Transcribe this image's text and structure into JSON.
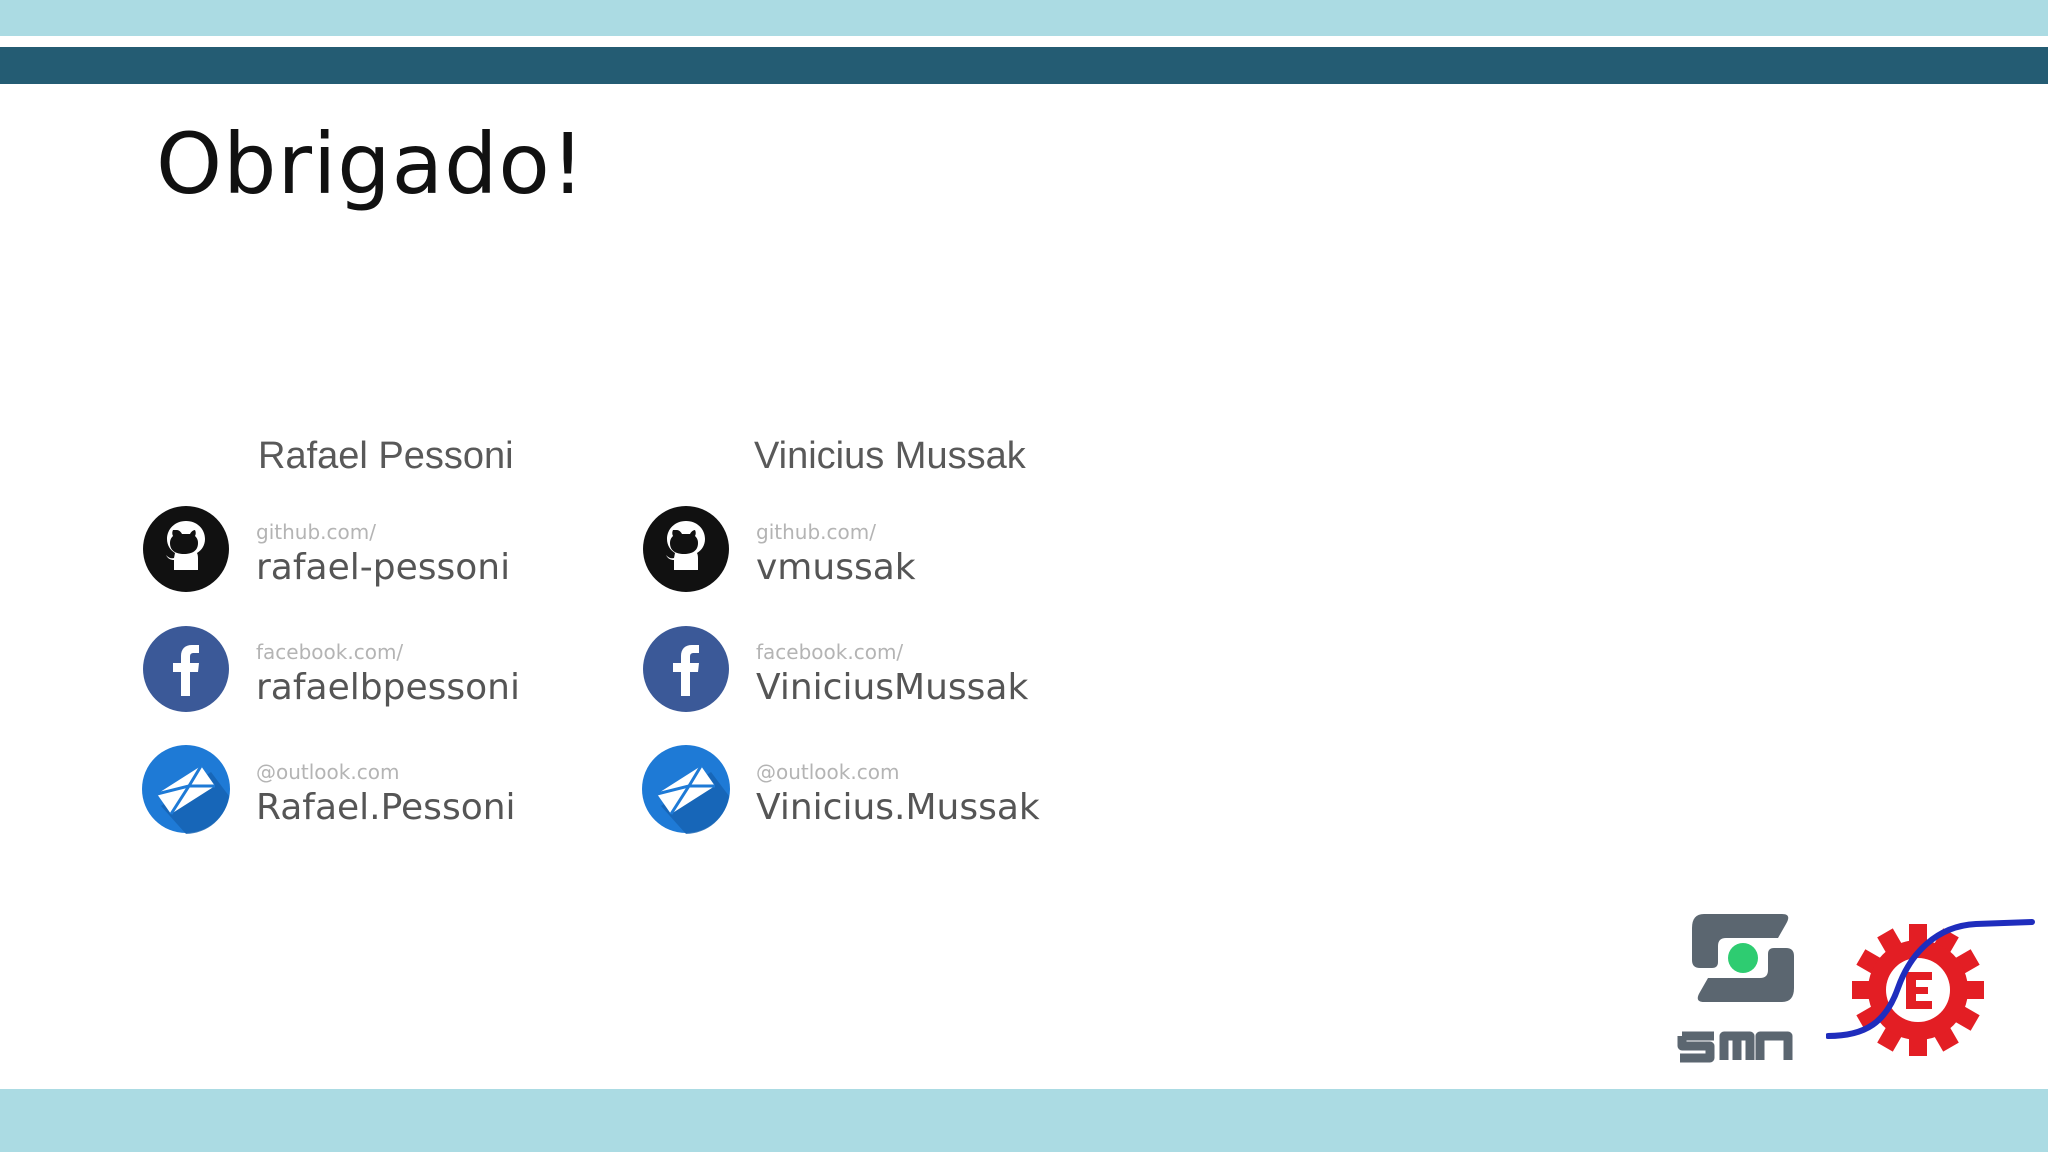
{
  "slide": {
    "title": "Obrigado!"
  },
  "people": [
    {
      "name": "Rafael Pessoni",
      "contacts": [
        {
          "icon": "github-icon",
          "prefix": "github.com/",
          "handle": "rafael-pessoni"
        },
        {
          "icon": "facebook-icon",
          "prefix": "facebook.com/",
          "handle": "rafaelbpessoni"
        },
        {
          "icon": "mail-icon",
          "prefix": "@outlook.com",
          "handle": "Rafael.Pessoni"
        }
      ]
    },
    {
      "name": "Vinicius Mussak",
      "contacts": [
        {
          "icon": "github-icon",
          "prefix": "github.com/",
          "handle": "vmussak"
        },
        {
          "icon": "facebook-icon",
          "prefix": "facebook.com/",
          "handle": "ViniciusMussak"
        },
        {
          "icon": "mail-icon",
          "prefix": "@outlook.com",
          "handle": "Vinicius.Mussak"
        }
      ]
    }
  ],
  "logos": {
    "smn_text": "SMN"
  },
  "colors": {
    "band_light": "#abdbe3",
    "band_dark": "#245c73",
    "github": "#111111",
    "facebook": "#3b5998",
    "mail": "#1e7ad6",
    "smn_gray": "#5b6670",
    "smn_green": "#2ecc71",
    "gear_red": "#e31e24",
    "curve_blue": "#1f2dbd"
  }
}
